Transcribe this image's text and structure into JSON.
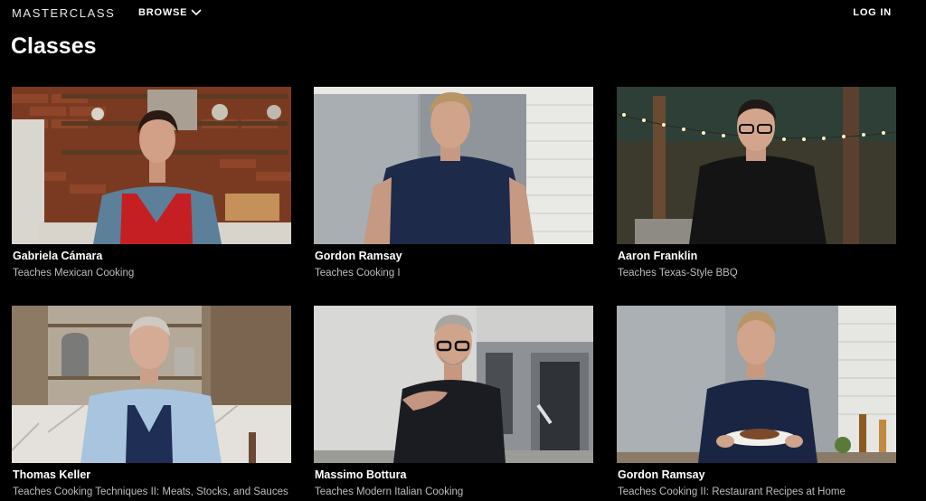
{
  "header": {
    "logo": "MASTERCLASS",
    "browse_label": "BROWSE",
    "login_label": "LOG IN"
  },
  "page": {
    "title": "Classes"
  },
  "classes": [
    {
      "instructor": "Gabriela Cámara",
      "subtitle": "Teaches Mexican Cooking"
    },
    {
      "instructor": "Gordon Ramsay",
      "subtitle": "Teaches Cooking I"
    },
    {
      "instructor": "Aaron Franklin",
      "subtitle": "Teaches Texas-Style BBQ"
    },
    {
      "instructor": "Thomas Keller",
      "subtitle": "Teaches Cooking Techniques II: Meats, Stocks, and Sauces"
    },
    {
      "instructor": "Massimo Bottura",
      "subtitle": "Teaches Modern Italian Cooking"
    },
    {
      "instructor": "Gordon Ramsay",
      "subtitle": "Teaches Cooking II: Restaurant Recipes at Home"
    }
  ]
}
